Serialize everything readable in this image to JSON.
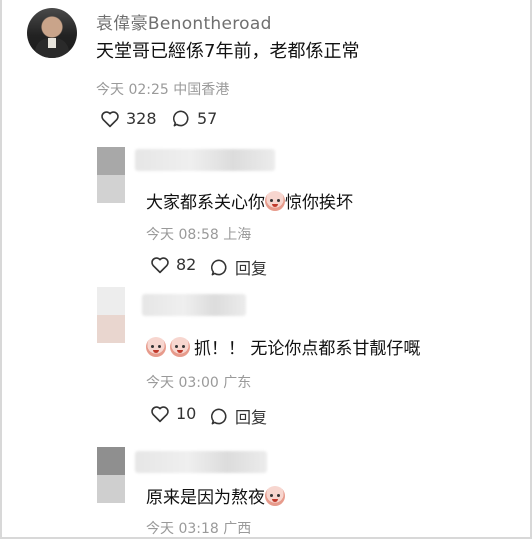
{
  "main_comment": {
    "username": "袁偉豪Benontheroad",
    "text": "天堂哥已經係7年前，老都係正常",
    "time": "今天 02:25",
    "location": "中国香港",
    "likes": "328",
    "comments": "57"
  },
  "replies": [
    {
      "text_before": "大家都系关心你",
      "text_after": "惊你挨坏",
      "time": "今天 08:58",
      "location": "上海",
      "likes": "82",
      "reply_label": "回复",
      "avatar_colors": [
        "#a8a8a8",
        "#d2d2d2"
      ]
    },
    {
      "text_after": "抓！！ 无论你点都系甘靓仔嘅",
      "time": "今天 03:00",
      "location": "广东",
      "likes": "10",
      "reply_label": "回复",
      "avatar_colors": [
        "#ededed",
        "#e9d6cf"
      ]
    },
    {
      "text_before": "原来是因为熬夜",
      "time": "今天 03:18",
      "location": "广西",
      "avatar_colors": [
        "#8f8f8f",
        "#cfcfcf"
      ]
    }
  ],
  "icons": {
    "like": "heart-outline-icon",
    "comment": "speech-bubble-icon",
    "emoji": "crying-face-emoji"
  }
}
